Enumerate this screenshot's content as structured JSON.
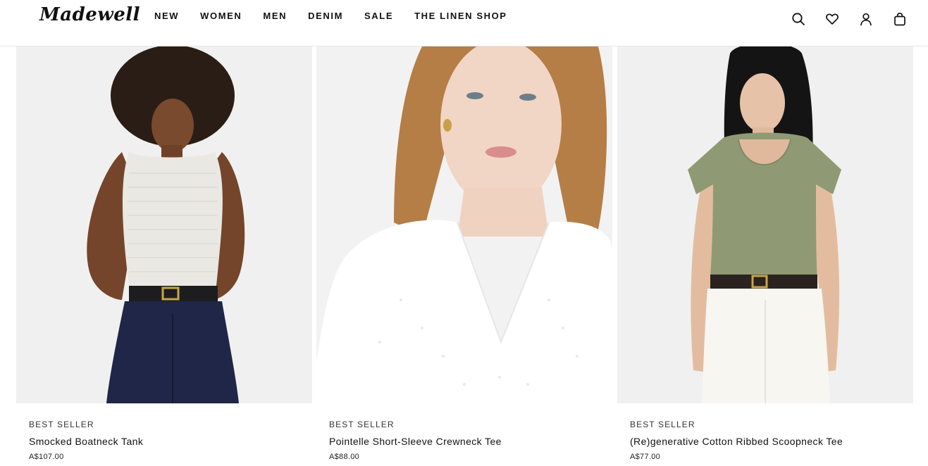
{
  "header": {
    "logo": "Madewell",
    "nav": [
      "NEW",
      "WOMEN",
      "MEN",
      "DENIM",
      "SALE",
      "THE LINEN SHOP"
    ],
    "icons": [
      "search-icon",
      "heart-icon",
      "account-icon",
      "bag-icon"
    ]
  },
  "products": [
    {
      "badge": "BEST SELLER",
      "name": "Smocked Boatneck Tank",
      "price": "A$107.00"
    },
    {
      "badge": "BEST SELLER",
      "name": "Pointelle Short-Sleeve Crewneck Tee",
      "price": "A$88.00"
    },
    {
      "badge": "BEST SELLER",
      "name": "(Re)generative Cotton Ribbed Scoopneck Tee",
      "price": "A$77.00"
    }
  ]
}
